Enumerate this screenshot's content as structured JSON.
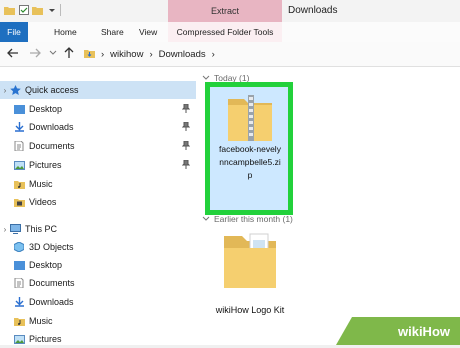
{
  "window": {
    "title": "Downloads",
    "context_tab": "Extract"
  },
  "ribbon": {
    "tabs": [
      "File",
      "Home",
      "Share",
      "View",
      "Compressed Folder Tools"
    ]
  },
  "address": {
    "crumbs": [
      "wikihow",
      "Downloads"
    ]
  },
  "nav_pane": {
    "items": [
      {
        "label": "Quick access",
        "icon": "star-icon",
        "pinned": false,
        "expand": ""
      },
      {
        "label": "Desktop",
        "icon": "desktop-folder-icon",
        "pinned": true
      },
      {
        "label": "Downloads",
        "icon": "downloads-folder-icon",
        "pinned": true
      },
      {
        "label": "Documents",
        "icon": "documents-folder-icon",
        "pinned": true
      },
      {
        "label": "Pictures",
        "icon": "pictures-folder-icon",
        "pinned": true
      },
      {
        "label": "Music",
        "icon": "music-folder-icon",
        "pinned": false
      },
      {
        "label": "Videos",
        "icon": "videos-folder-icon",
        "pinned": false
      },
      {
        "label": "This PC",
        "icon": "pc-icon",
        "pinned": false
      },
      {
        "label": "3D Objects",
        "icon": "3d-objects-icon",
        "pinned": false
      },
      {
        "label": "Desktop",
        "icon": "desktop-folder-icon",
        "pinned": false
      },
      {
        "label": "Documents",
        "icon": "documents-folder-icon",
        "pinned": false
      },
      {
        "label": "Downloads",
        "icon": "downloads-folder-icon",
        "pinned": false
      },
      {
        "label": "Music",
        "icon": "music-folder-icon",
        "pinned": false
      },
      {
        "label": "Pictures",
        "icon": "pictures-folder-icon",
        "pinned": false
      }
    ]
  },
  "content": {
    "groups": [
      {
        "label": "Today (1)"
      },
      {
        "label": "Earlier this month (1)"
      }
    ],
    "files": [
      {
        "name": "facebook-nevelynncampbelle5.zip",
        "name_lines": [
          "facebook-nevely",
          "nncampbelle5.zi",
          "p"
        ],
        "selected": true,
        "icon": "zip-folder-icon"
      },
      {
        "name": "wikiHow Logo Kit",
        "selected": false,
        "icon": "folder-icon"
      }
    ]
  },
  "watermark": {
    "text": "wikiHow"
  },
  "colors": {
    "highlight": "#22d13b",
    "selection": "#cde8ff",
    "accent": "#1e6fc0"
  }
}
